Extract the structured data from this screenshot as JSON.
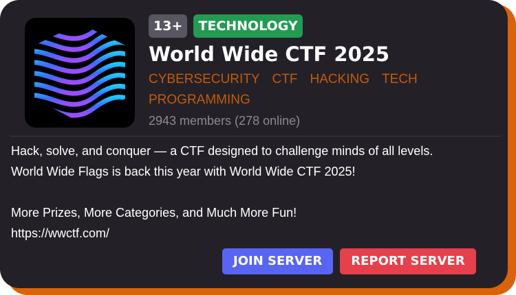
{
  "server": {
    "age_badge": "13+",
    "category_badge": "TECHNOLOGY",
    "title": "World Wide CTF 2025",
    "tags": [
      "CYBERSECURITY",
      "CTF",
      "HACKING",
      "TECH",
      "PROGRAMMING"
    ],
    "members_text": "2943 members (278 online)"
  },
  "description": {
    "line1": "Hack, solve, and conquer — a CTF designed to challenge minds of all levels.",
    "line2": "World Wide Flags is back this year with World Wide CTF 2025!",
    "line3": "More Prizes, More Categories, and Much More Fun!",
    "line4": "https://wwctf.com/"
  },
  "actions": {
    "join_label": "JOIN SERVER",
    "report_label": "REPORT SERVER"
  },
  "colors": {
    "card_bg": "#232127",
    "accent_shadow": "#d9620a",
    "tag_color": "#c45a0c",
    "category_badge": "#239b53",
    "age_badge": "#585761",
    "join_button": "#5865f2",
    "report_button": "#e5404b"
  },
  "icons": {
    "logo": "wave-sphere-logo-icon"
  }
}
